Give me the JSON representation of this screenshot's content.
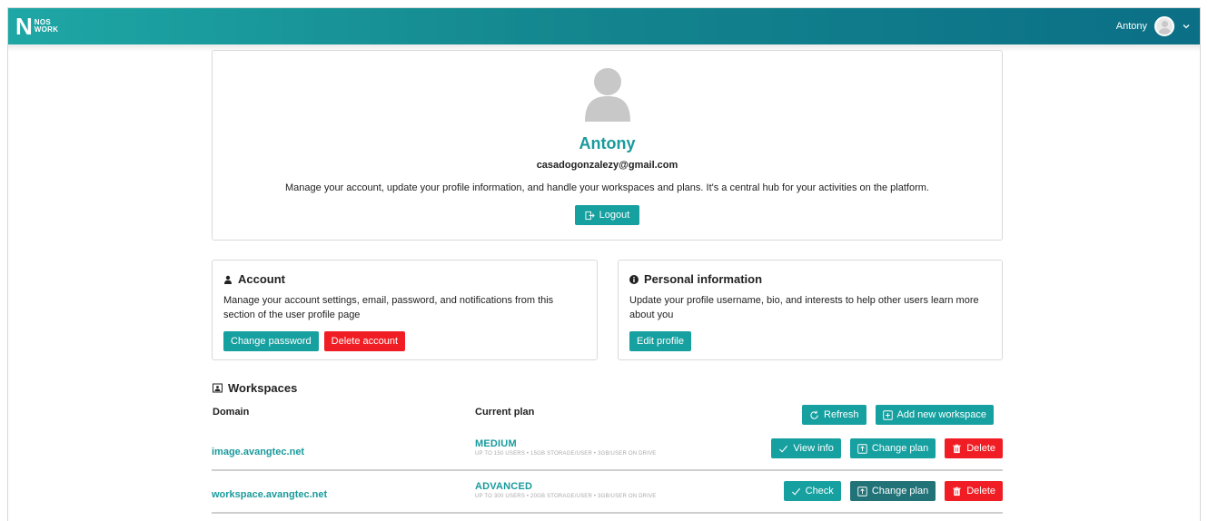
{
  "header": {
    "logo_letter": "N",
    "logo_line1": "NOS",
    "logo_line2": "WORK",
    "user_name": "Antony"
  },
  "profile": {
    "name": "Antony",
    "email": "casadogonzalezy@gmail.com",
    "description": "Manage your account, update your profile information, and handle your workspaces and plans. It's a central hub for your activities on the platform.",
    "logout_label": "Logout"
  },
  "account": {
    "title": "Account",
    "description": "Manage your account settings, email, password, and notifications from this section of the user profile page",
    "change_password_label": "Change password",
    "delete_account_label": "Delete account"
  },
  "personal": {
    "title": "Personal information",
    "description": "Update your profile username, bio, and interests to help other users learn more about you",
    "edit_profile_label": "Edit profile"
  },
  "workspaces": {
    "title": "Workspaces",
    "col_domain": "Domain",
    "col_plan": "Current plan",
    "refresh_label": "Refresh",
    "add_label": "Add new workspace",
    "rows": [
      {
        "domain": "image.avangtec.net",
        "plan": "MEDIUM",
        "plan_details": "UP TO 150 USERS • 15GB STORAGE/USER • 3GB/USER ON DRIVE",
        "primary_label": "View info",
        "change_label": "Change plan",
        "delete_label": "Delete"
      },
      {
        "domain": "workspace.avangtec.net",
        "plan": "ADVANCED",
        "plan_details": "UP TO 300 USERS • 20GB STORAGE/USER • 3GB/USER ON DRIVE",
        "primary_label": "Check",
        "change_label": "Change plan",
        "delete_label": "Delete"
      }
    ]
  },
  "colors": {
    "accent": "#17a0a0",
    "accent_dark": "#227378",
    "danger": "#f01e24",
    "header_start": "#1ea7a5",
    "header_end": "#0b6f86"
  }
}
